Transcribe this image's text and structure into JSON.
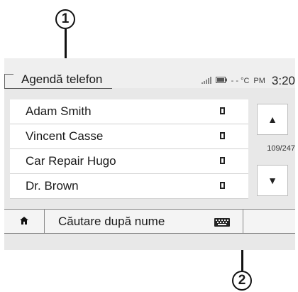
{
  "callouts": [
    "1",
    "2"
  ],
  "header": {
    "title": "Agendă telefon",
    "status": {
      "signal_icon": "signal-icon",
      "battery_icon": "battery-icon",
      "temperature": "- - °C",
      "ampm": "PM",
      "time": "3:20"
    }
  },
  "contacts": [
    {
      "name": "Adam Smith",
      "icon": "phone-icon"
    },
    {
      "name": "Vincent Casse",
      "icon": "phone-icon"
    },
    {
      "name": "Car Repair Hugo",
      "icon": "phone-icon"
    },
    {
      "name": "Dr. Brown",
      "icon": "phone-icon"
    }
  ],
  "scroll": {
    "up_icon": "▲",
    "down_icon": "▼",
    "page_counter": "109/247"
  },
  "bottom": {
    "home_icon": "home-icon",
    "search_label": "Căutare după nume",
    "keyboard_icon": "keyboard-icon"
  }
}
